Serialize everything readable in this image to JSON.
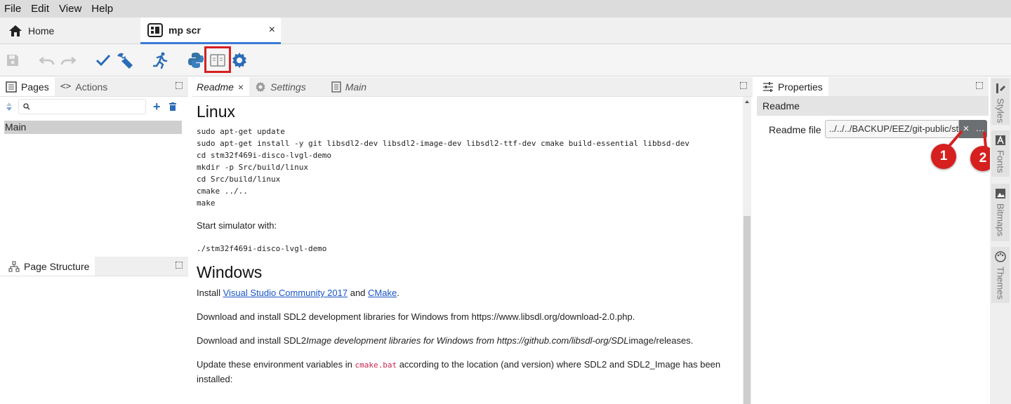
{
  "menu": [
    "File",
    "Edit",
    "View",
    "Help"
  ],
  "tabs": {
    "home": "Home",
    "active": "mp scr",
    "close": "×"
  },
  "left_panel": {
    "tab_pages": "Pages",
    "tab_actions": "Actions",
    "search_placeholder": "",
    "pages": [
      "Main"
    ],
    "structure_title": "Page Structure"
  },
  "center": {
    "tabs": [
      "Readme",
      "Settings",
      "Main"
    ],
    "tab_close": "×",
    "readme": {
      "h_linux": "Linux",
      "linux_code": "sudo apt-get update\nsudo apt-get install -y git libsdl2-dev libsdl2-image-dev libsdl2-ttf-dev cmake build-essential libbsd-dev\ncd stm32f469i-disco-lvgl-demo\nmkdir -p Src/build/linux\ncd Src/build/linux\ncmake ../..\nmake",
      "start_sim": "Start simulator with:",
      "sim_code": "./stm32f469i-disco-lvgl-demo",
      "h_windows": "Windows",
      "install_1": "Install ",
      "install_link1": "Visual Studio Community 2017",
      "install_and": " and ",
      "install_link2": "CMake",
      "install_end": ".",
      "p_download1": "Download and install SDL2 development libraries for Windows from https://www.libsdl.org/download-2.0.php.",
      "p_download2_a": "Download and install SDL2",
      "p_download2_b": "Image development libraries for Windows from https://github.com/libsdl-org/SDL",
      "p_download2_c": "image/releases.",
      "p_update_a": "Update these environment variables in ",
      "p_update_code": "cmake.bat",
      "p_update_b": " according to the location (and version) where SDL2 and SDL2_Image has been installed:"
    }
  },
  "properties": {
    "tab": "Properties",
    "section": "Readme",
    "field_label": "Readme file",
    "field_value": "../../../BACKUP/EEZ/git-public/st",
    "clear": "×",
    "browse": "…"
  },
  "sidebar": [
    "Styles",
    "Fonts",
    "Bitmaps",
    "Themes"
  ],
  "badges": [
    "1",
    "2"
  ],
  "colors": {
    "accent": "#3a7bd5",
    "highlight": "#d62020",
    "badge": "#d62020"
  }
}
